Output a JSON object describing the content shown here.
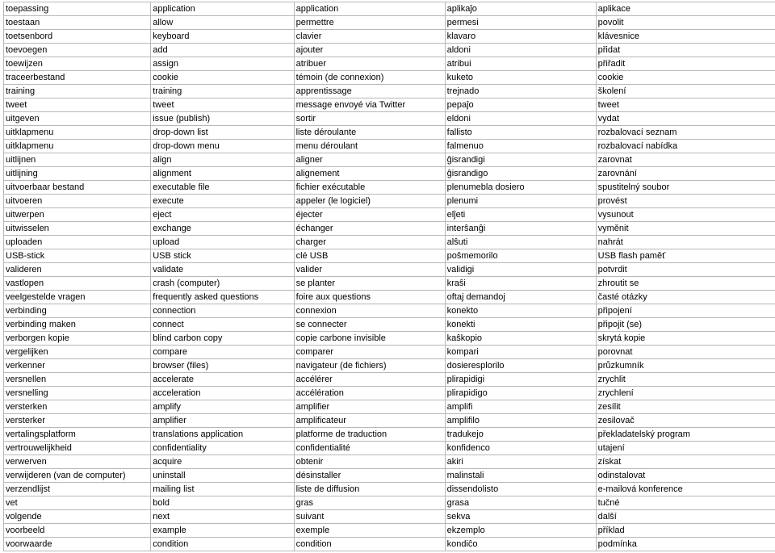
{
  "rows": [
    [
      "toepassing",
      "application",
      "application",
      "aplikaĵo",
      "aplikace"
    ],
    [
      "toestaan",
      "allow",
      "permettre",
      "permesi",
      "povolit"
    ],
    [
      "toetsenbord",
      "keyboard",
      "clavier",
      "klavaro",
      "klávesnice"
    ],
    [
      "toevoegen",
      "add",
      "ajouter",
      "aldoni",
      "přidat"
    ],
    [
      "toewijzen",
      "assign",
      "atribuer",
      "atribui",
      "přiřadit"
    ],
    [
      "traceerbestand",
      "cookie",
      "témoin (de connexion)",
      "kuketo",
      "cookie"
    ],
    [
      "training",
      "training",
      "apprentissage",
      "trejnado",
      "školení"
    ],
    [
      "tweet",
      "tweet",
      "message envoyé via Twitter",
      "pepaĵo",
      "tweet"
    ],
    [
      "uitgeven",
      "issue (publish)",
      "sortir",
      "eldoni",
      "vydat"
    ],
    [
      "uitklapmenu",
      "drop-down list",
      "liste déroulante",
      "fallisto",
      "rozbalovací seznam"
    ],
    [
      "uitklapmenu",
      "drop-down menu",
      "menu déroulant",
      "falmenuo",
      "rozbalovací nabídka"
    ],
    [
      "uitlijnen",
      "align",
      "aligner",
      "ĝisrandigi",
      "zarovnat"
    ],
    [
      "uitlijning",
      "alignment",
      "alignement",
      "ĝisrandigo",
      "zarovnání"
    ],
    [
      "uitvoerbaar bestand",
      "executable file",
      "fichier exécutable",
      "plenumebla dosiero",
      "spustitelný soubor"
    ],
    [
      "uitvoeren",
      "execute",
      "appeler (le logiciel)",
      "plenumi",
      "provést"
    ],
    [
      "uitwerpen",
      "eject",
      "éjecter",
      "elĵeti",
      "vysunout"
    ],
    [
      "uitwisselen",
      "exchange",
      "échanger",
      "interŝanĝi",
      "vyměnit"
    ],
    [
      "uploaden",
      "upload",
      "charger",
      "alŝuti",
      "nahrát"
    ],
    [
      "USB-stick",
      "USB stick",
      "clé USB",
      "poŝmemorilo",
      "USB flash paměť"
    ],
    [
      "valideren",
      "validate",
      "valider",
      "validigi",
      "potvrdit"
    ],
    [
      "vastlopen",
      "crash (computer)",
      "se planter",
      "kraŝi",
      "zhroutit se"
    ],
    [
      "veelgestelde vragen",
      "frequently asked questions",
      "foire aux questions",
      "oftaj demandoj",
      "časté otázky"
    ],
    [
      "verbinding",
      "connection",
      "connexion",
      "konekto",
      "připojení"
    ],
    [
      "verbinding maken",
      "connect",
      "se connecter",
      "konekti",
      "připojit (se)"
    ],
    [
      "verborgen kopie",
      "blind carbon copy",
      "copie carbone invisible",
      "kaŝkopio",
      "skrytá kopie"
    ],
    [
      "vergelijken",
      "compare",
      "comparer",
      "kompari",
      "porovnat"
    ],
    [
      "verkenner",
      "browser (files)",
      "navigateur (de fichiers)",
      "dosieresplorilo",
      "průzkumník"
    ],
    [
      "versnellen",
      "accelerate",
      "accélérer",
      "plirapidigi",
      "zrychlit"
    ],
    [
      "versnelling",
      "acceleration",
      "accélération",
      "plirapidigo",
      "zrychlení"
    ],
    [
      "versterken",
      "amplify",
      "amplifier",
      "amplifi",
      "zesílit"
    ],
    [
      "versterker",
      "amplifier",
      "amplificateur",
      "amplifilo",
      "zesilovač"
    ],
    [
      "vertalingsplatform",
      "translations application",
      "platforme de traduction",
      "tradukejo",
      "překladatelský program"
    ],
    [
      "vertrouwelijkheid",
      "confidentiality",
      "confidentialité",
      "konfidenco",
      "utajení"
    ],
    [
      "verwerven",
      "acquire",
      "obtenir",
      "akiri",
      "získat"
    ],
    [
      "verwijderen (van de computer)",
      "uninstall",
      "désinstaller",
      "malinstali",
      "odinstalovat"
    ],
    [
      "verzendlijst",
      "mailing list",
      "liste de diffusion",
      "dissendolisto",
      "e-mailová konference"
    ],
    [
      "vet",
      "bold",
      "gras",
      "grasa",
      "tučné"
    ],
    [
      "volgende",
      "next",
      "suivant",
      "sekva",
      "další"
    ],
    [
      "voorbeeld",
      "example",
      "exemple",
      "ekzemplo",
      "příklad"
    ],
    [
      "voorwaarde",
      "condition",
      "condition",
      "kondiĉo",
      "podmínka"
    ]
  ]
}
